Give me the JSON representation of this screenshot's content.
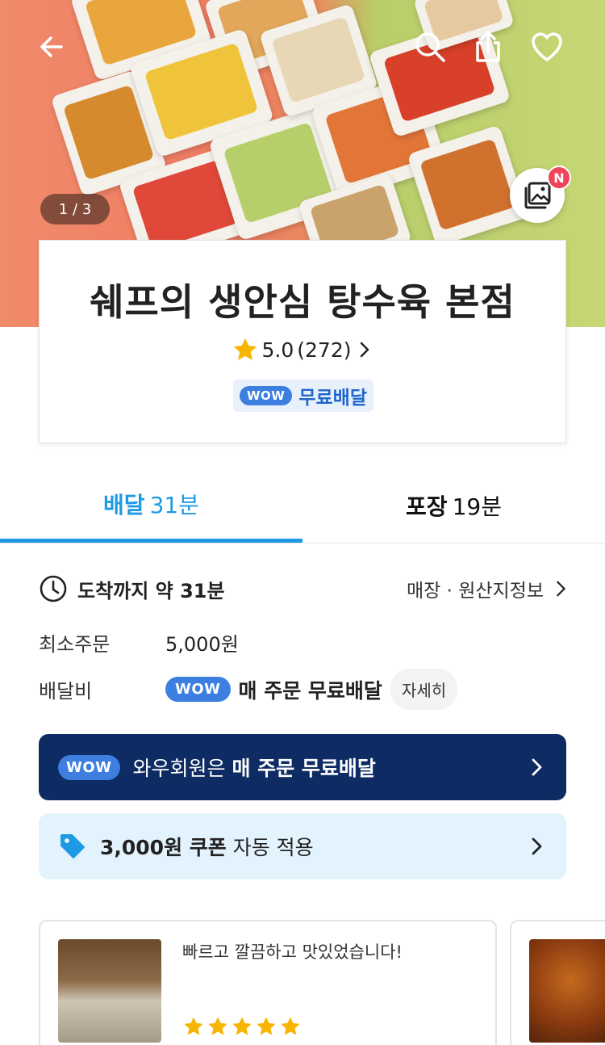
{
  "hero": {
    "image_counter": "1 / 3",
    "new_badge": "N",
    "icons": [
      "back-arrow-icon",
      "search-icon",
      "share-icon",
      "heart-icon",
      "gallery-icon"
    ]
  },
  "store": {
    "name": "쉐프의 생안심 탕수육 본점",
    "rating": "5.0",
    "review_count": "(272)",
    "wow_label": "WOW",
    "free_delivery_label": "무료배달"
  },
  "tabs": {
    "delivery": {
      "label": "배달",
      "time": "31분"
    },
    "pickup": {
      "label": "포장",
      "time": "19분"
    }
  },
  "info": {
    "eta_label": "도착까지 약 31분",
    "origin_link": "매장 · 원산지정보",
    "min_order_label": "최소주문",
    "min_order_value": "5,000원",
    "delivery_fee_label": "배달비",
    "fee_wow": "WOW",
    "fee_text": "매 주문 무료배달",
    "detail_button": "자세히"
  },
  "banners": {
    "wow": {
      "tag": "WOW",
      "prefix": "와우회원은 ",
      "bold": "매 주문 무료배달"
    },
    "coupon": {
      "bold": "3,000원 쿠폰",
      "suffix": " 자동 적용"
    }
  },
  "reviews": [
    {
      "text": "빠르고 깔끔하고 맛있었습니다!",
      "stars": 5
    }
  ],
  "colors": {
    "accent": "#1e9ae5",
    "wow_blue": "#3c7fe0",
    "navy_banner": "#0e2c63",
    "coupon_bg": "#e3f3fd",
    "star": "#f7b500"
  }
}
